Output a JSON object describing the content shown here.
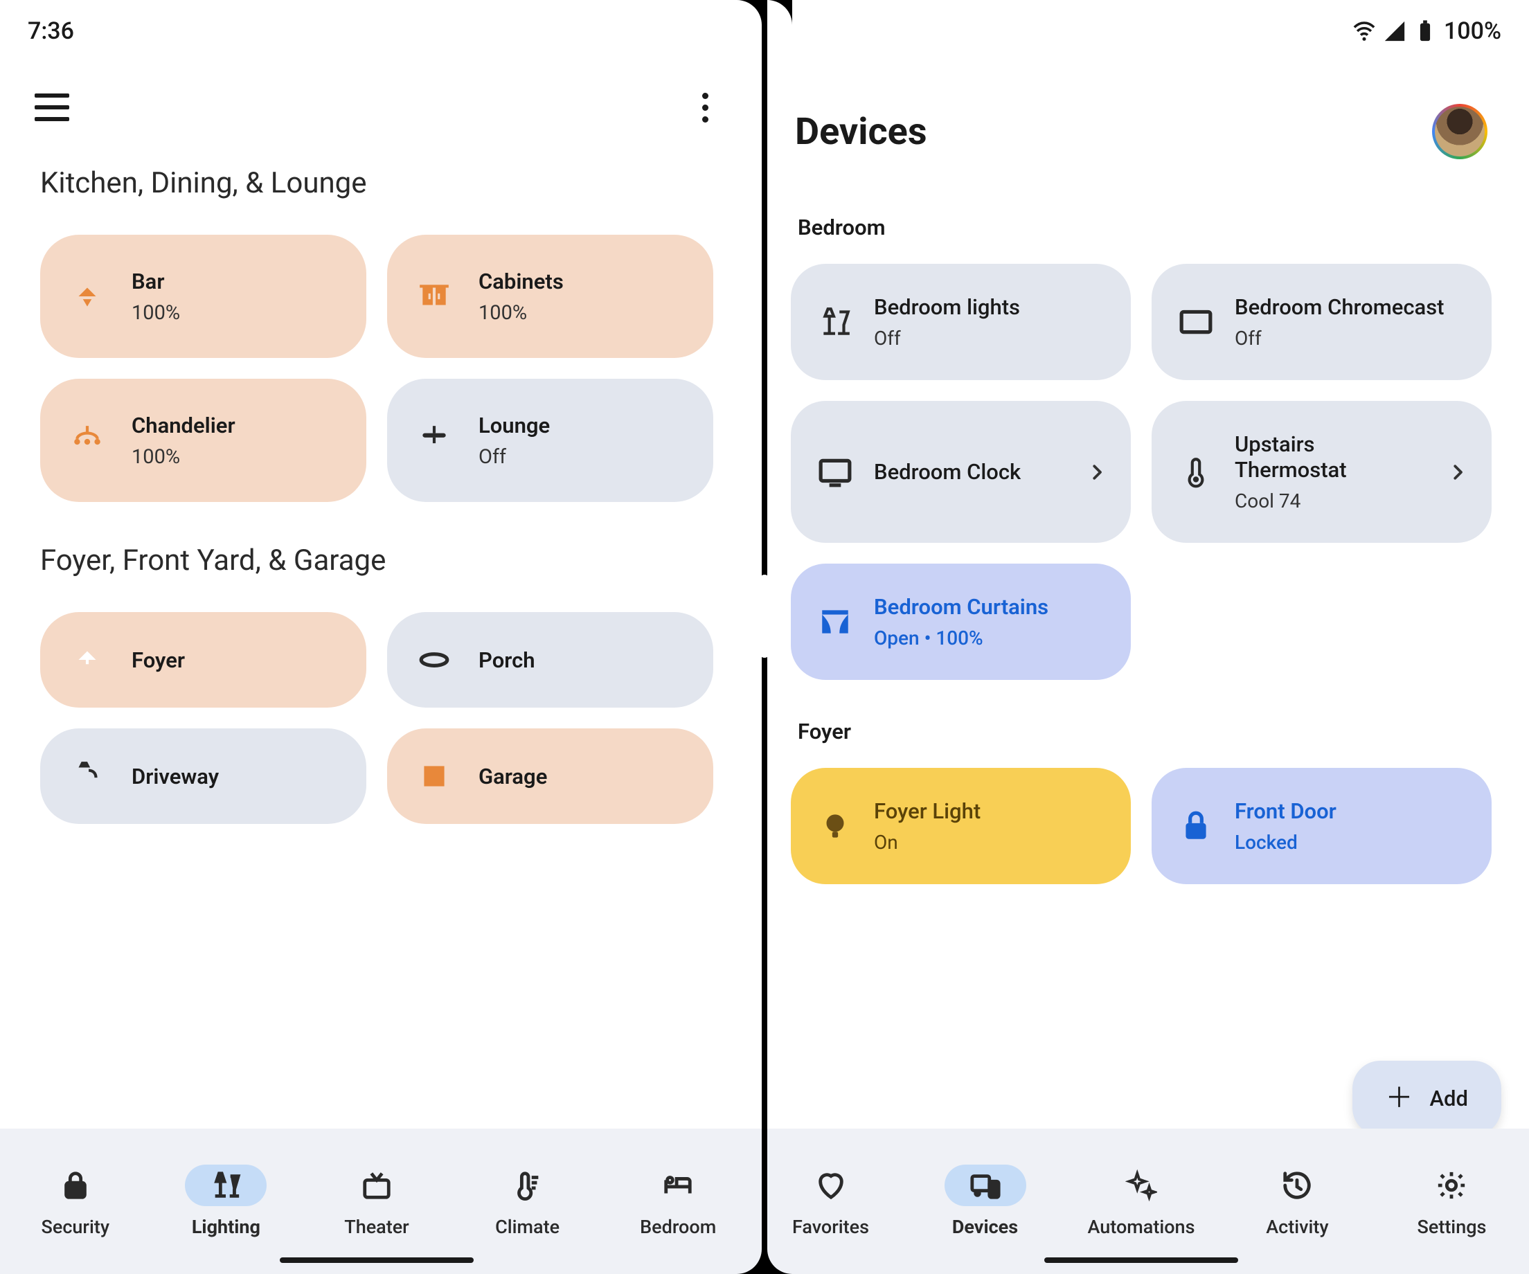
{
  "status": {
    "time": "7:36",
    "battery": "100%"
  },
  "left": {
    "sections": [
      {
        "title": "Kitchen, Dining, & Lounge",
        "cards": [
          {
            "name": "Bar",
            "sub": "100%",
            "icon": "pendant",
            "style": "peach",
            "iconColor": "orange"
          },
          {
            "name": "Cabinets",
            "sub": "100%",
            "icon": "cabinets",
            "style": "peach",
            "iconColor": "orange"
          },
          {
            "name": "Chandelier",
            "sub": "100%",
            "icon": "chandelier",
            "style": "peach",
            "iconColor": "orange"
          },
          {
            "name": "Lounge",
            "sub": "Off",
            "icon": "fan",
            "style": "gray",
            "iconColor": "dark"
          }
        ]
      },
      {
        "title": "Foyer, Front Yard, & Garage",
        "cards": [
          {
            "name": "Foyer",
            "sub": "",
            "icon": "pendant-center",
            "style": "peach",
            "iconColor": "white",
            "short": true
          },
          {
            "name": "Porch",
            "sub": "",
            "icon": "recessed",
            "style": "gray",
            "iconColor": "dark",
            "short": true
          },
          {
            "name": "Driveway",
            "sub": "",
            "icon": "lamp-post",
            "style": "gray",
            "iconColor": "dark",
            "short": true
          },
          {
            "name": "Garage",
            "sub": "",
            "icon": "square",
            "style": "peach",
            "iconColor": "redish",
            "short": true
          }
        ]
      }
    ],
    "nav": [
      {
        "label": "Security",
        "icon": "lock",
        "active": false
      },
      {
        "label": "Lighting",
        "icon": "lamp-nav",
        "active": true
      },
      {
        "label": "Theater",
        "icon": "tv-antenna",
        "active": false
      },
      {
        "label": "Climate",
        "icon": "thermo-nav",
        "active": false
      },
      {
        "label": "Bedroom",
        "icon": "bed",
        "active": false
      }
    ]
  },
  "right": {
    "title": "Devices",
    "groups": [
      {
        "title": "Bedroom",
        "cards": [
          {
            "name": "Bedroom lights",
            "sub": "Off",
            "icon": "lamp-floor",
            "style": "gray",
            "chevron": false
          },
          {
            "name": "Bedroom Chromecast",
            "sub": "Off",
            "icon": "rect-tv",
            "style": "gray",
            "chevron": false
          },
          {
            "name": "Bedroom Clock",
            "sub": "",
            "icon": "display",
            "style": "gray",
            "chevron": true
          },
          {
            "name": "Upstairs Thermostat",
            "sub": "Cool 74",
            "icon": "thermometer",
            "style": "gray",
            "chevron": true
          },
          {
            "name": "Bedroom Curtains",
            "sub": "Open • 100%",
            "icon": "curtains",
            "style": "blue-lt",
            "chevron": false,
            "iconColor": "blue"
          }
        ]
      },
      {
        "title": "Foyer",
        "cards": [
          {
            "name": "Foyer Light",
            "sub": "On",
            "icon": "bulb",
            "style": "yellow",
            "iconColor": "brown"
          },
          {
            "name": "Front Door",
            "sub": "Locked",
            "icon": "lock-filled",
            "style": "blue-lt",
            "iconColor": "blue"
          }
        ]
      }
    ],
    "fab": {
      "label": "Add"
    },
    "nav": [
      {
        "label": "Favorites",
        "icon": "heart",
        "active": false
      },
      {
        "label": "Devices",
        "icon": "devices",
        "active": true
      },
      {
        "label": "Automations",
        "icon": "sparkle",
        "active": false
      },
      {
        "label": "Activity",
        "icon": "history",
        "active": false
      },
      {
        "label": "Settings",
        "icon": "gear",
        "active": false
      }
    ]
  }
}
